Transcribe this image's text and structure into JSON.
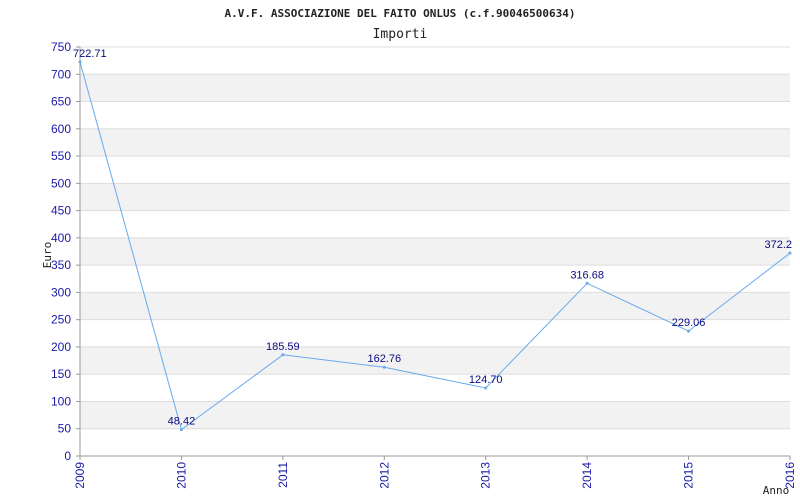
{
  "chart_data": {
    "type": "line",
    "title": "A.V.F. ASSOCIAZIONE DEL FAITO ONLUS (c.f.90046500634)",
    "subtitle": "Importi",
    "ylabel": "Euro",
    "xlabel": "Anno",
    "categories": [
      "2009",
      "2010",
      "2011",
      "2012",
      "2013",
      "2014",
      "2015",
      "2016"
    ],
    "series": [
      {
        "values": [
          722.71,
          48.42,
          185.59,
          162.76,
          124.7,
          316.68,
          229.06,
          372.2
        ],
        "labels": [
          "722.71",
          "48.42",
          "185.59",
          "162.76",
          "124.70",
          "316.68",
          "229.06",
          "372.2"
        ]
      }
    ],
    "ylim": [
      0,
      750
    ],
    "yticks": [
      0,
      50,
      100,
      150,
      200,
      250,
      300,
      350,
      400,
      450,
      500,
      550,
      600,
      650,
      700,
      750
    ],
    "grid": true,
    "colors": {
      "line": "#66aaee",
      "band": "#f2f2f2",
      "gridline": "#dddddd",
      "axis": "#999999",
      "tick_text": "#1a1aa6",
      "label_text": "#0a0a80"
    }
  }
}
